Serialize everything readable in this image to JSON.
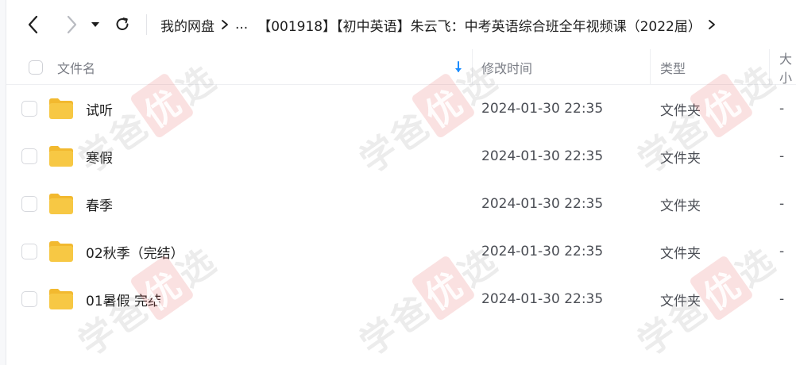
{
  "nav": {
    "breadcrumb": {
      "root": "我的网盘",
      "ellipsis": "...",
      "current": "【001918】【初中英语】朱云飞：中考英语综合班全年视频课（2022届）"
    }
  },
  "table": {
    "headers": {
      "name": "文件名",
      "modified": "修改时间",
      "type": "类型",
      "size": "大小"
    },
    "rows": [
      {
        "name": "试听",
        "modified": "2024-01-30 22:35",
        "type": "文件夹",
        "size": "-"
      },
      {
        "name": "寒假",
        "modified": "2024-01-30 22:35",
        "type": "文件夹",
        "size": "-"
      },
      {
        "name": "春季",
        "modified": "2024-01-30 22:35",
        "type": "文件夹",
        "size": "-"
      },
      {
        "name": "02秋季（完结）",
        "modified": "2024-01-30 22:35",
        "type": "文件夹",
        "size": "-"
      },
      {
        "name": "01暑假 完结",
        "modified": "2024-01-30 22:35",
        "type": "文件夹",
        "size": "-"
      }
    ]
  },
  "watermark": {
    "part1": "学爸",
    "part2": "优",
    "part3": "选"
  },
  "colors": {
    "folder_fill": "#f7c844",
    "folder_tab": "#f2b92f",
    "sort_icon": "#1a8cff",
    "header_text": "#7a7d85",
    "border": "#eeeff2"
  },
  "icons": [
    "back-arrow-icon",
    "forward-arrow-icon",
    "dropdown-triangle-icon",
    "refresh-icon",
    "chevron-right-icon",
    "sort-down-icon",
    "folder-icon"
  ]
}
